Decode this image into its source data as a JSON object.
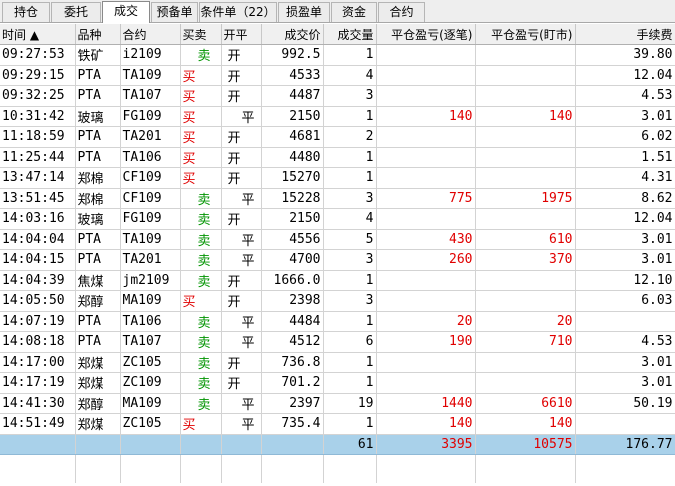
{
  "tabs": [
    "持仓",
    "委托",
    "成交",
    "预备单",
    "条件单（22）",
    "损盈单",
    "资金",
    "合约"
  ],
  "columns": {
    "time": "时间 ▲",
    "product": "品种",
    "contract": "合约",
    "side": "买卖",
    "openclose": "开平",
    "price": "成交价",
    "qty": "成交量",
    "pnl_mark": "平仓盈亏(逐笔)",
    "pnl_daily": "平仓盈亏(盯市)",
    "fee": "手续费"
  },
  "rows": [
    {
      "time": "09:27:53",
      "product": "铁矿",
      "contract": "i2109",
      "side": "卖",
      "oc": "开",
      "price": "992.5",
      "qty": "1",
      "pnl_mark": "",
      "pnl_daily": "",
      "fee": "39.80"
    },
    {
      "time": "09:29:15",
      "product": "PTA",
      "contract": "TA109",
      "side": "买",
      "oc": "开",
      "price": "4533",
      "qty": "4",
      "pnl_mark": "",
      "pnl_daily": "",
      "fee": "12.04"
    },
    {
      "time": "09:32:25",
      "product": "PTA",
      "contract": "TA107",
      "side": "买",
      "oc": "开",
      "price": "4487",
      "qty": "3",
      "pnl_mark": "",
      "pnl_daily": "",
      "fee": "4.53"
    },
    {
      "time": "10:31:42",
      "product": "玻璃",
      "contract": "FG109",
      "side": "买",
      "oc": "平",
      "price": "2150",
      "qty": "1",
      "pnl_mark": "140",
      "pnl_daily": "140",
      "fee": "3.01"
    },
    {
      "time": "11:18:59",
      "product": "PTA",
      "contract": "TA201",
      "side": "买",
      "oc": "开",
      "price": "4681",
      "qty": "2",
      "pnl_mark": "",
      "pnl_daily": "",
      "fee": "6.02"
    },
    {
      "time": "11:25:44",
      "product": "PTA",
      "contract": "TA106",
      "side": "买",
      "oc": "开",
      "price": "4480",
      "qty": "1",
      "pnl_mark": "",
      "pnl_daily": "",
      "fee": "1.51"
    },
    {
      "time": "13:47:14",
      "product": "郑棉",
      "contract": "CF109",
      "side": "买",
      "oc": "开",
      "price": "15270",
      "qty": "1",
      "pnl_mark": "",
      "pnl_daily": "",
      "fee": "4.31"
    },
    {
      "time": "13:51:45",
      "product": "郑棉",
      "contract": "CF109",
      "side": "卖",
      "oc": "平",
      "price": "15228",
      "qty": "3",
      "pnl_mark": "775",
      "pnl_daily": "1975",
      "fee": "8.62"
    },
    {
      "time": "14:03:16",
      "product": "玻璃",
      "contract": "FG109",
      "side": "卖",
      "oc": "开",
      "price": "2150",
      "qty": "4",
      "pnl_mark": "",
      "pnl_daily": "",
      "fee": "12.04"
    },
    {
      "time": "14:04:04",
      "product": "PTA",
      "contract": "TA109",
      "side": "卖",
      "oc": "平",
      "price": "4556",
      "qty": "5",
      "pnl_mark": "430",
      "pnl_daily": "610",
      "fee": "3.01"
    },
    {
      "time": "14:04:15",
      "product": "PTA",
      "contract": "TA201",
      "side": "卖",
      "oc": "平",
      "price": "4700",
      "qty": "3",
      "pnl_mark": "260",
      "pnl_daily": "370",
      "fee": "3.01"
    },
    {
      "time": "14:04:39",
      "product": "焦煤",
      "contract": "jm2109",
      "side": "卖",
      "oc": "开",
      "price": "1666.0",
      "qty": "1",
      "pnl_mark": "",
      "pnl_daily": "",
      "fee": "12.10"
    },
    {
      "time": "14:05:50",
      "product": "郑醇",
      "contract": "MA109",
      "side": "买",
      "oc": "开",
      "price": "2398",
      "qty": "3",
      "pnl_mark": "",
      "pnl_daily": "",
      "fee": "6.03"
    },
    {
      "time": "14:07:19",
      "product": "PTA",
      "contract": "TA106",
      "side": "卖",
      "oc": "平",
      "price": "4484",
      "qty": "1",
      "pnl_mark": "20",
      "pnl_daily": "20",
      "fee": ""
    },
    {
      "time": "14:08:18",
      "product": "PTA",
      "contract": "TA107",
      "side": "卖",
      "oc": "平",
      "price": "4512",
      "qty": "6",
      "pnl_mark": "190",
      "pnl_daily": "710",
      "fee": "4.53"
    },
    {
      "time": "14:17:00",
      "product": "郑煤",
      "contract": "ZC105",
      "side": "卖",
      "oc": "开",
      "price": "736.8",
      "qty": "1",
      "pnl_mark": "",
      "pnl_daily": "",
      "fee": "3.01"
    },
    {
      "time": "14:17:19",
      "product": "郑煤",
      "contract": "ZC109",
      "side": "卖",
      "oc": "开",
      "price": "701.2",
      "qty": "1",
      "pnl_mark": "",
      "pnl_daily": "",
      "fee": "3.01"
    },
    {
      "time": "14:41:30",
      "product": "郑醇",
      "contract": "MA109",
      "side": "卖",
      "oc": "平",
      "price": "2397",
      "qty": "19",
      "pnl_mark": "1440",
      "pnl_daily": "6610",
      "fee": "50.19"
    },
    {
      "time": "14:51:49",
      "product": "郑煤",
      "contract": "ZC105",
      "side": "买",
      "oc": "平",
      "price": "735.4",
      "qty": "1",
      "pnl_mark": "140",
      "pnl_daily": "140",
      "fee": ""
    }
  ],
  "total": {
    "qty": "61",
    "pnl_mark": "3395",
    "pnl_daily": "10575",
    "fee": "176.77"
  },
  "colors": {
    "buy": "#e00000",
    "sell": "#009400",
    "total_row": "#a9d1ea"
  }
}
